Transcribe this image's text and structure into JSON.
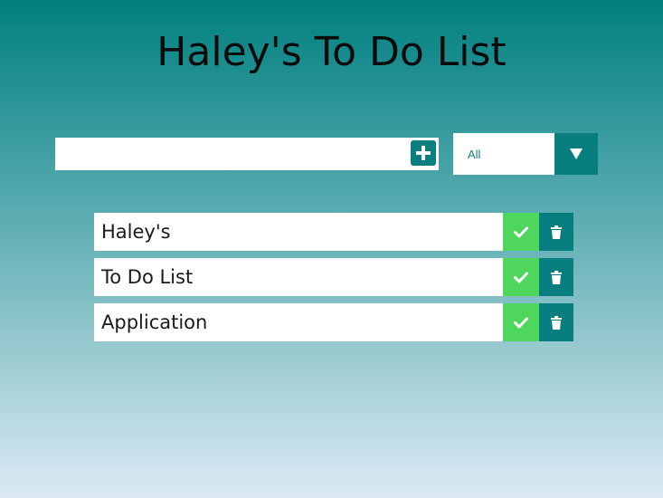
{
  "header": {
    "title": "Haley's To Do List"
  },
  "add_form": {
    "input_value": "",
    "add_icon": "plus-square-icon"
  },
  "filter": {
    "selected": "All",
    "arrow_icon": "triangle-down-icon"
  },
  "todos": [
    {
      "text": "Haley's",
      "complete_icon": "check-icon",
      "delete_icon": "trash-icon"
    },
    {
      "text": "To Do List",
      "complete_icon": "check-icon",
      "delete_icon": "trash-icon"
    },
    {
      "text": "Application",
      "complete_icon": "check-icon",
      "delete_icon": "trash-icon"
    }
  ],
  "colors": {
    "accent": "#087e7e",
    "complete": "#4fd65d",
    "filter_text": "#137f80"
  }
}
